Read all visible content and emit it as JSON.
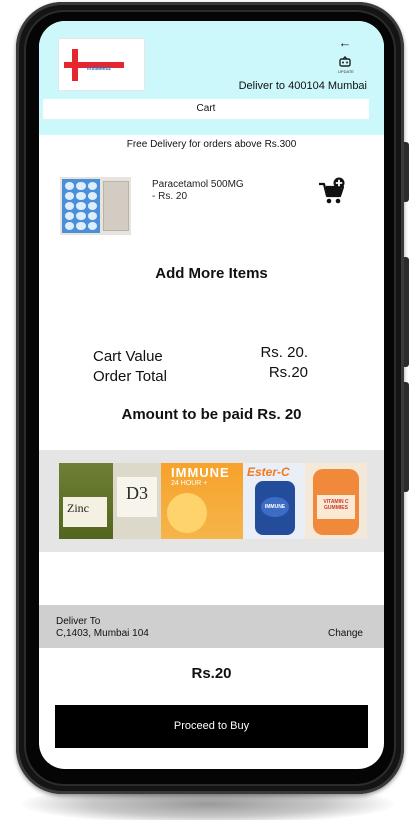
{
  "header": {
    "logo_text": "InstaMedz",
    "back_icon": "back-arrow-icon",
    "location_icon": "gps-location-icon",
    "location_label": "UPDATE",
    "deliver_to": "Deliver to 400104 Mumbai",
    "page_title": "Cart"
  },
  "notice": "Free Delivery for orders above Rs.300",
  "cart_item": {
    "name": "Paracetamol 500MG",
    "price": "- Rs. 20",
    "add_icon": "add-to-cart-icon"
  },
  "add_more": "Add More Items",
  "summary": {
    "cart_value_label": "Cart Value",
    "order_total_label": "Order Total",
    "cart_value": "Rs. 20.",
    "order_total": "Rs.20"
  },
  "amount_to_pay": "Amount to be paid Rs. 20",
  "banner": {
    "zinc": "Zinc",
    "d3": "D3",
    "immune": "IMMUNE",
    "immune_sub": "24 HOUR +",
    "ester": "Ester-C",
    "ester_badge": "IMMUNE",
    "vitc": "VITAMIN C GUMMIES"
  },
  "delivery": {
    "label": "Deliver To",
    "address": "C,1403, Mumbai 104",
    "change": "Change"
  },
  "total": "Rs.20",
  "proceed_button": "Proceed to Buy",
  "colors": {
    "header_bg": "#ccf8fb",
    "banner_strip_bg": "#e5e5e5",
    "delivery_bg": "#cfcfcf",
    "button_bg": "#000000",
    "brand_red": "#e6262d"
  }
}
